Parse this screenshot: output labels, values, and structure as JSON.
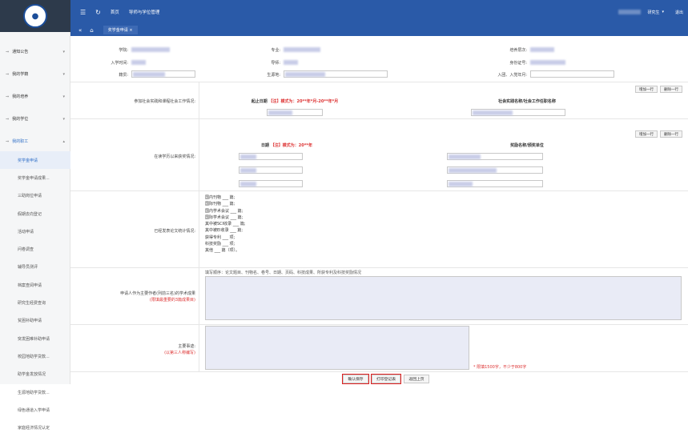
{
  "topbar": {
    "home": "首页",
    "module": "导师与学位管理",
    "user_role": "研究生",
    "logout": "退出"
  },
  "tabbar": {
    "tab": "奖学金申请"
  },
  "sidebar": {
    "items": [
      {
        "label": "通知公告"
      },
      {
        "label": "我的学籍"
      },
      {
        "label": "我的培养"
      },
      {
        "label": "我的学位"
      },
      {
        "label": "我的职工"
      }
    ],
    "subs": [
      "奖学金申请",
      "奖学金申请成果...",
      "三助岗位申请",
      "假期去向登记",
      "活动申请",
      "问卷调查",
      "辅导员测评",
      "档案查阅申请",
      "研究生经费查询",
      "贫困补助申请",
      "突发困难补助申请",
      "校园地助学贷款...",
      "助学金发放情况",
      "生源地助学贷款...",
      "绿色通道入学申请",
      "家庭经济情况认定"
    ]
  },
  "form": {
    "college_label": "学院:",
    "major_label": "专业:",
    "train_label": "培养层次:",
    "enroll_label": "入学时间:",
    "tutor_label": "导师:",
    "id_label": "身份证号:",
    "native_label": "籍贯:",
    "birth_label": "生源地:",
    "party_label": "入团、入党年月:",
    "social_label": "参加社会实践和课程社会工作情况:",
    "social_col1": "起止日期",
    "social_col1_note": "【注】模式为：20**年*月-20**年*月",
    "social_col2": "社会实践名称/社会工作任职名称",
    "add_row": "增加一行",
    "del_row": "删除一行",
    "award_label": "在读学历以来获奖情况:",
    "award_col1": "日期",
    "award_col1_note": "【注】模式为：20**年",
    "award_col2": "奖励名称/颁奖单位",
    "paper_label": "已经发表论文统计情况:",
    "paper_lines": [
      "国内刊物 ___ 篇;",
      "国际刊物 ___ 篇;",
      "国内学术会议 ___ 篇;",
      "国际学术会议 ___ 篇;",
      "其中被SCI收录 ___ 篇;",
      "其中被EI收录 ___ 篇;",
      "获得专利 ___ 项;",
      "科技奖励 ___ 项;",
      "其他 ___ 篇（项）。"
    ],
    "paper_note": "填写顺序：论文题目、刊物名、卷号、日期、页码、科技成果、所获专利及科技奖励情况",
    "main_label": "申请人作为主要作者(列前三名)的学术成果",
    "main_label_red": "(限填最重要的3篇成果目)",
    "deeds_label": "主要事迹:",
    "deeds_red": "(以第三人称编写)",
    "deeds_note": "* 限填1500字，不少于800字",
    "btn_save": "确认保存",
    "btn_print": "打印登记表",
    "btn_back": "返回上页"
  }
}
